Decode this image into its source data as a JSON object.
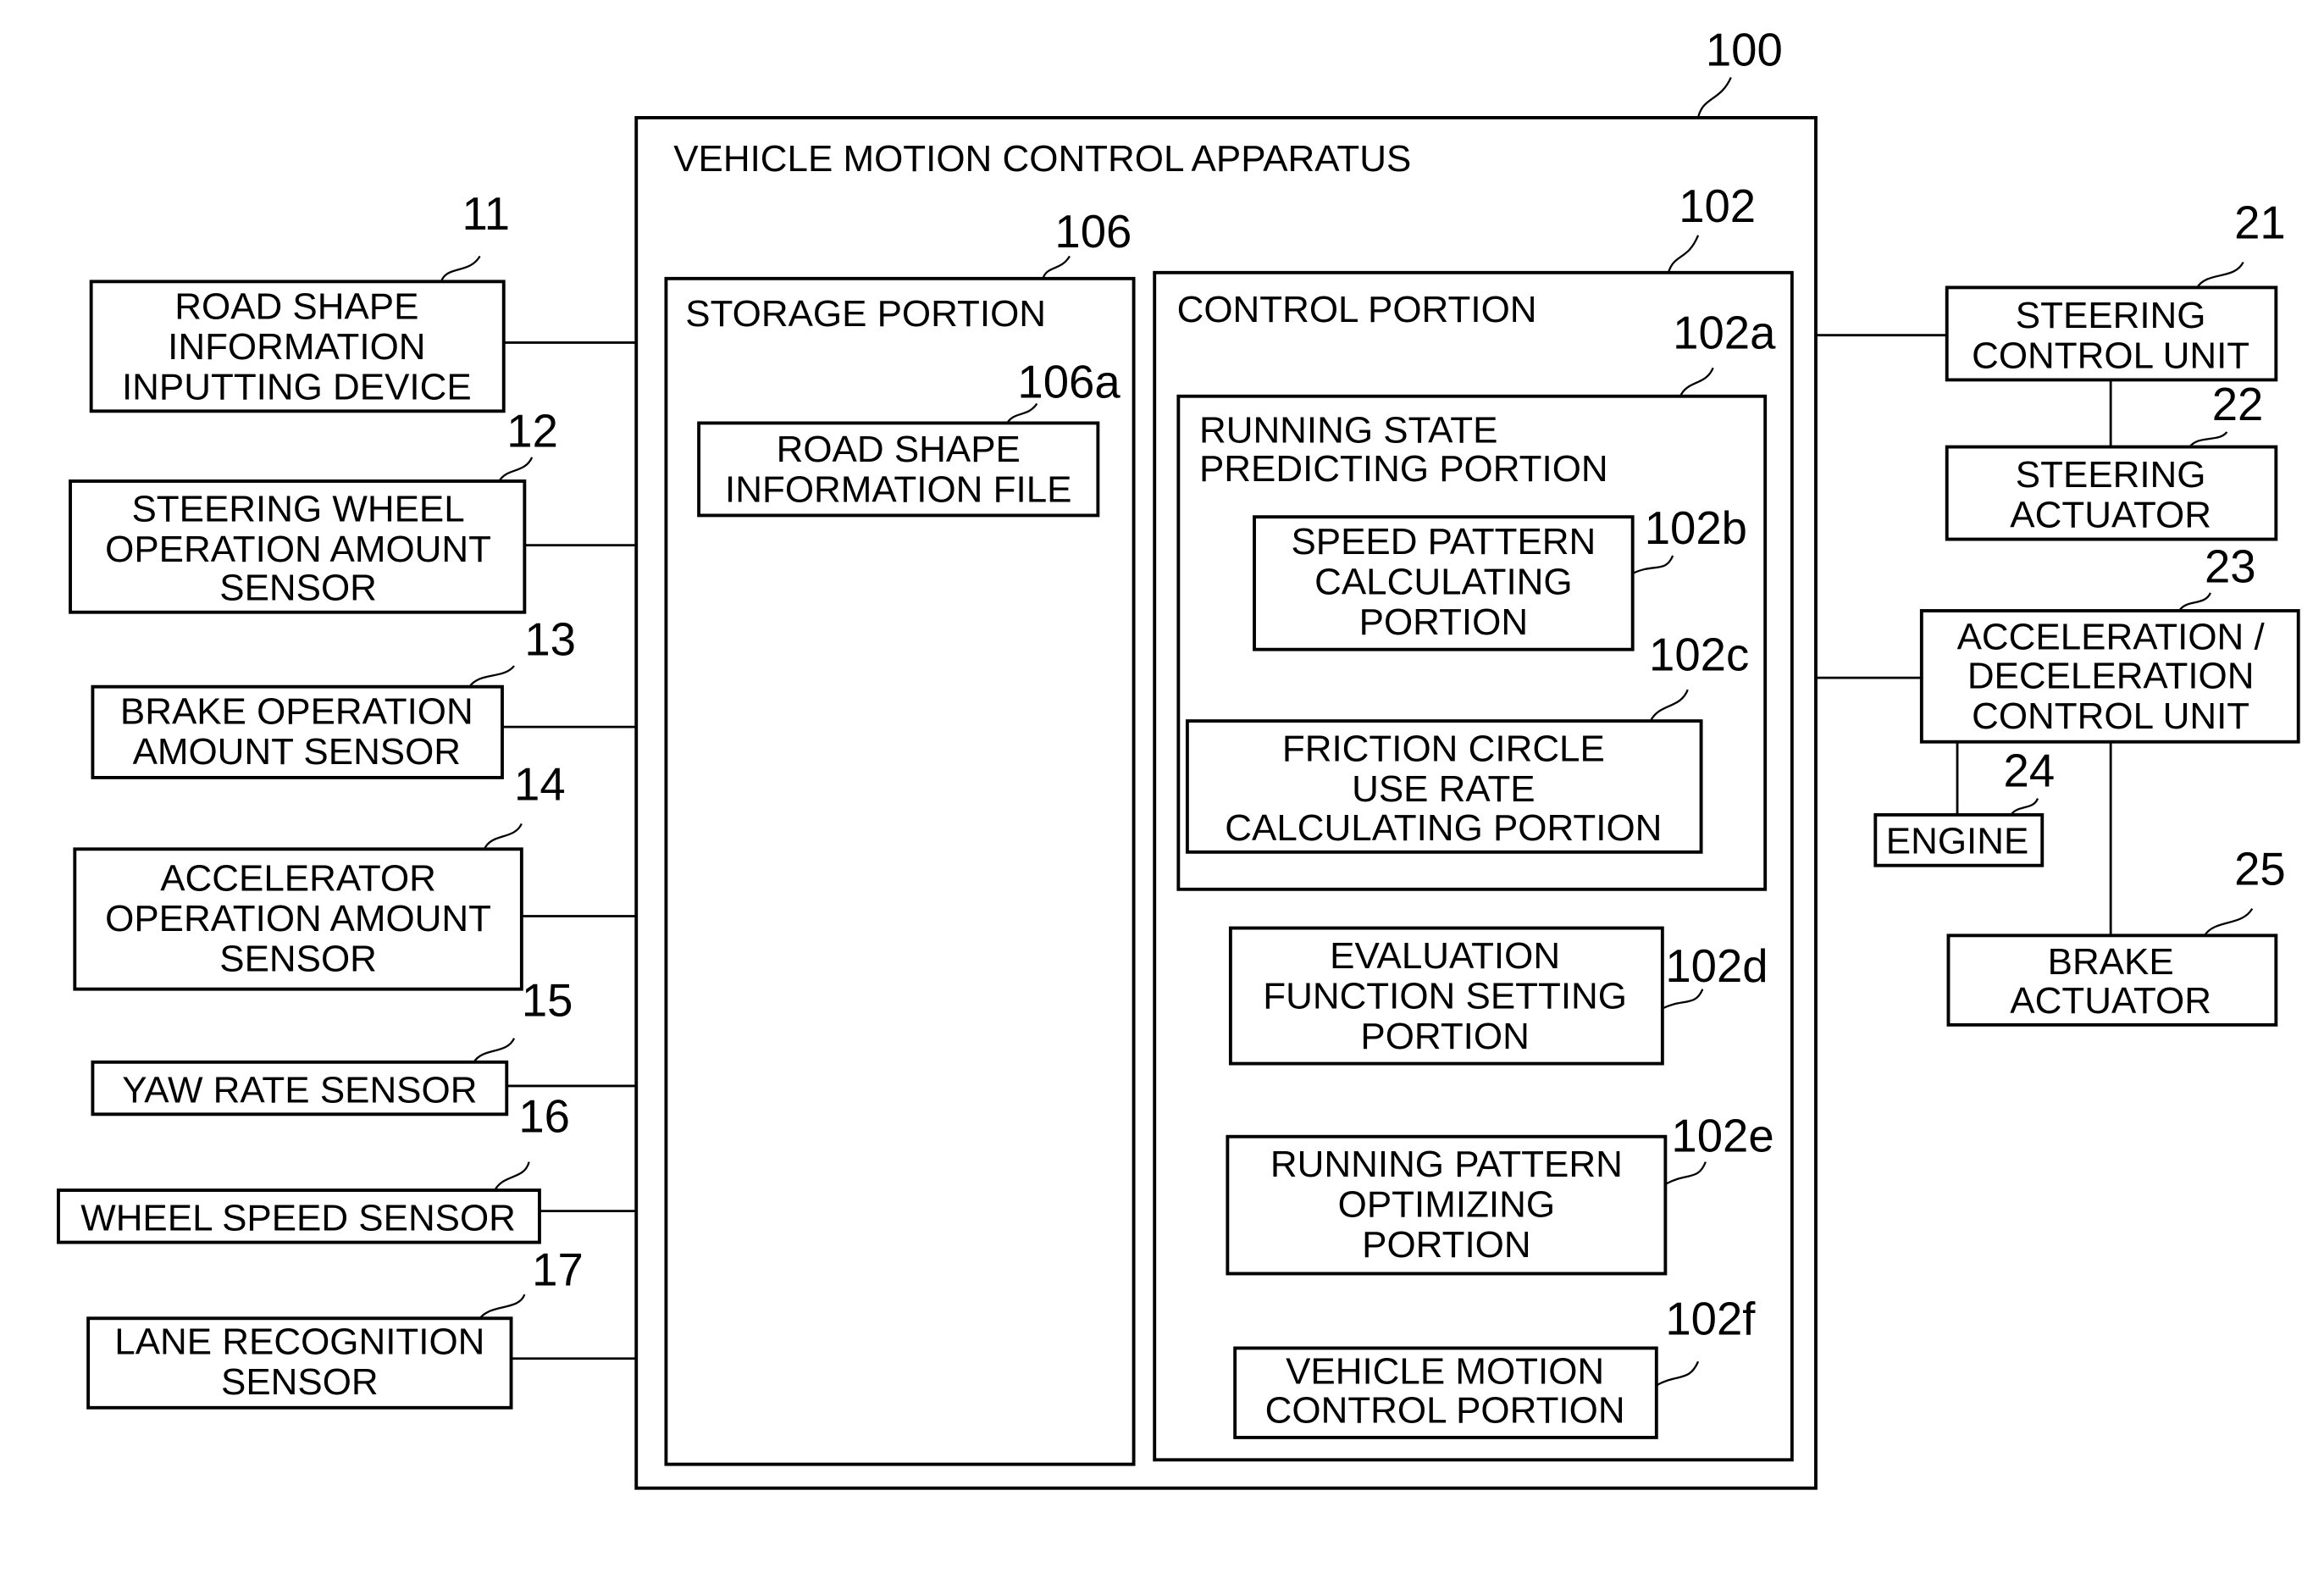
{
  "apparatus": {
    "ref": "100",
    "title": "VEHICLE MOTION CONTROL APPARATUS"
  },
  "storage": {
    "ref": "106",
    "title": "STORAGE PORTION",
    "file": {
      "ref": "106a",
      "lines": [
        "ROAD SHAPE",
        "INFORMATION FILE"
      ]
    }
  },
  "control": {
    "ref": "102",
    "title": "CONTROL PORTION",
    "running_state": {
      "ref": "102a",
      "lines": [
        "RUNNING STATE",
        "PREDICTING PORTION"
      ],
      "speed_pattern": {
        "ref": "102b",
        "lines": [
          "SPEED PATTERN",
          "CALCULATING",
          "PORTION"
        ]
      },
      "friction_circle": {
        "ref": "102c",
        "lines": [
          "FRICTION CIRCLE",
          "USE RATE",
          "CALCULATING PORTION"
        ]
      }
    },
    "evaluation": {
      "ref": "102d",
      "lines": [
        "EVALUATION",
        "FUNCTION SETTING",
        "PORTION"
      ]
    },
    "optimizing": {
      "ref": "102e",
      "lines": [
        "RUNNING PATTERN",
        "OPTIMIZING",
        "PORTION"
      ]
    },
    "motion_control": {
      "ref": "102f",
      "lines": [
        "VEHICLE MOTION",
        "CONTROL PORTION"
      ]
    }
  },
  "inputs": [
    {
      "ref": "11",
      "lines": [
        "ROAD SHAPE",
        "INFORMATION",
        "INPUTTING DEVICE"
      ]
    },
    {
      "ref": "12",
      "lines": [
        "STEERING WHEEL",
        "OPERATION AMOUNT",
        "SENSOR"
      ]
    },
    {
      "ref": "13",
      "lines": [
        "BRAKE OPERATION",
        "AMOUNT SENSOR"
      ]
    },
    {
      "ref": "14",
      "lines": [
        "ACCELERATOR",
        "OPERATION AMOUNT",
        "SENSOR"
      ]
    },
    {
      "ref": "15",
      "lines": [
        "YAW RATE SENSOR"
      ]
    },
    {
      "ref": "16",
      "lines": [
        "WHEEL SPEED SENSOR"
      ]
    },
    {
      "ref": "17",
      "lines": [
        "LANE RECOGNITION",
        "SENSOR"
      ]
    }
  ],
  "outputs": [
    {
      "ref": "21",
      "lines": [
        "STEERING",
        "CONTROL UNIT"
      ]
    },
    {
      "ref": "22",
      "lines": [
        "STEERING",
        "ACTUATOR"
      ]
    },
    {
      "ref": "23",
      "lines": [
        "ACCELERATION /",
        "DECELERATION",
        "CONTROL UNIT"
      ]
    },
    {
      "ref": "24",
      "lines": [
        "ENGINE"
      ]
    },
    {
      "ref": "25",
      "lines": [
        "BRAKE",
        "ACTUATOR"
      ]
    }
  ]
}
